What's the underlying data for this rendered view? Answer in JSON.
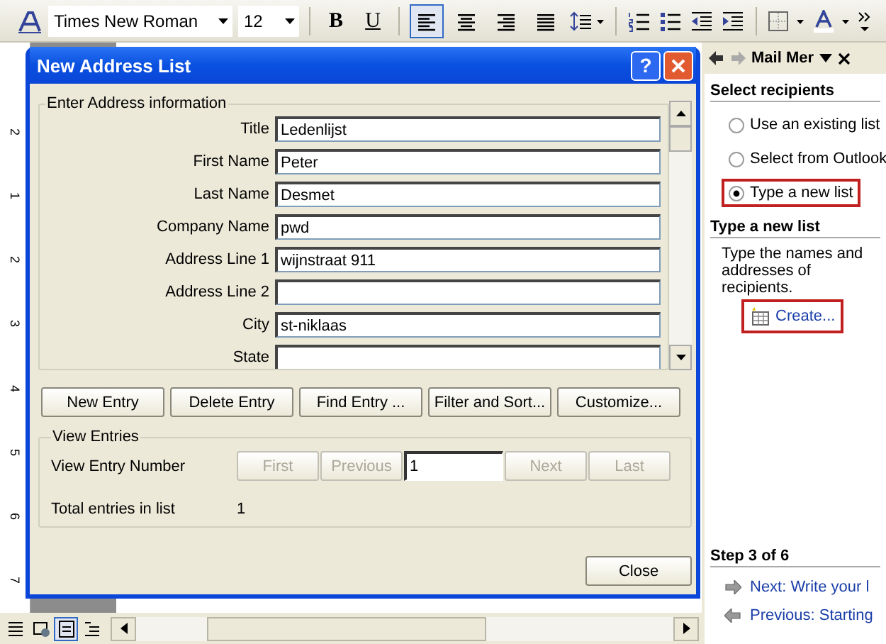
{
  "toolbar": {
    "font": "Times New Roman",
    "size": "12",
    "bold": "B",
    "underline": "U",
    "align": [
      {
        "kind": "left",
        "selected": true
      },
      {
        "kind": "center",
        "selected": false
      },
      {
        "kind": "right",
        "selected": false
      },
      {
        "kind": "justify",
        "selected": false
      }
    ]
  },
  "ruler": {
    "labels": [
      "2",
      "1",
      "2",
      "3",
      "4",
      "5",
      "6",
      "7"
    ]
  },
  "dialog": {
    "title": "New Address List",
    "help": "?",
    "group": "Enter Address information",
    "fields": [
      {
        "label": "Title",
        "value": "Ledenlijst"
      },
      {
        "label": "First Name",
        "value": "Peter"
      },
      {
        "label": "Last Name",
        "value": "Desmet"
      },
      {
        "label": "Company Name",
        "value": "pwd"
      },
      {
        "label": "Address Line 1",
        "value": "wijnstraat 911"
      },
      {
        "label": "Address Line 2"
      },
      {
        "label": "City",
        "value": "st-niklaas"
      },
      {
        "label": "State"
      }
    ],
    "buttons": [
      "New Entry",
      "Delete Entry",
      "Find Entry ...",
      "Filter and Sort...",
      "Customize..."
    ],
    "view": {
      "group": "View Entries",
      "label": "View Entry Number",
      "number": "1",
      "nav": [
        {
          "label": "First",
          "disabled": true
        },
        {
          "label": "Previous",
          "disabled": true
        },
        {
          "label": "Next",
          "disabled": true
        },
        {
          "label": "Last",
          "disabled": true
        }
      ],
      "total_label": "Total entries in list",
      "total": "1"
    },
    "close": "Close"
  },
  "task_pane": {
    "title": "Mail Mer",
    "section": "Select recipients",
    "options": [
      {
        "label": "Use an existing list",
        "selected": false,
        "highlighted": false
      },
      {
        "label": "Select from Outlook",
        "selected": false,
        "highlighted": false
      },
      {
        "label": "Type a new list",
        "selected": true,
        "highlighted": true
      }
    ],
    "subsection": "Type a new list",
    "description": "Type the names and addresses of recipients.",
    "create": {
      "label": "Create...",
      "highlighted": true
    },
    "step": "Step 3 of 6",
    "links": [
      {
        "kind": "next",
        "label": "Next: Write your l"
      },
      {
        "kind": "previous",
        "label": "Previous: Starting"
      }
    ]
  },
  "views": [
    {
      "kind": "normal",
      "selected": false
    },
    {
      "kind": "web",
      "selected": false
    },
    {
      "kind": "print",
      "selected": true
    },
    {
      "kind": "outline",
      "selected": false
    }
  ]
}
